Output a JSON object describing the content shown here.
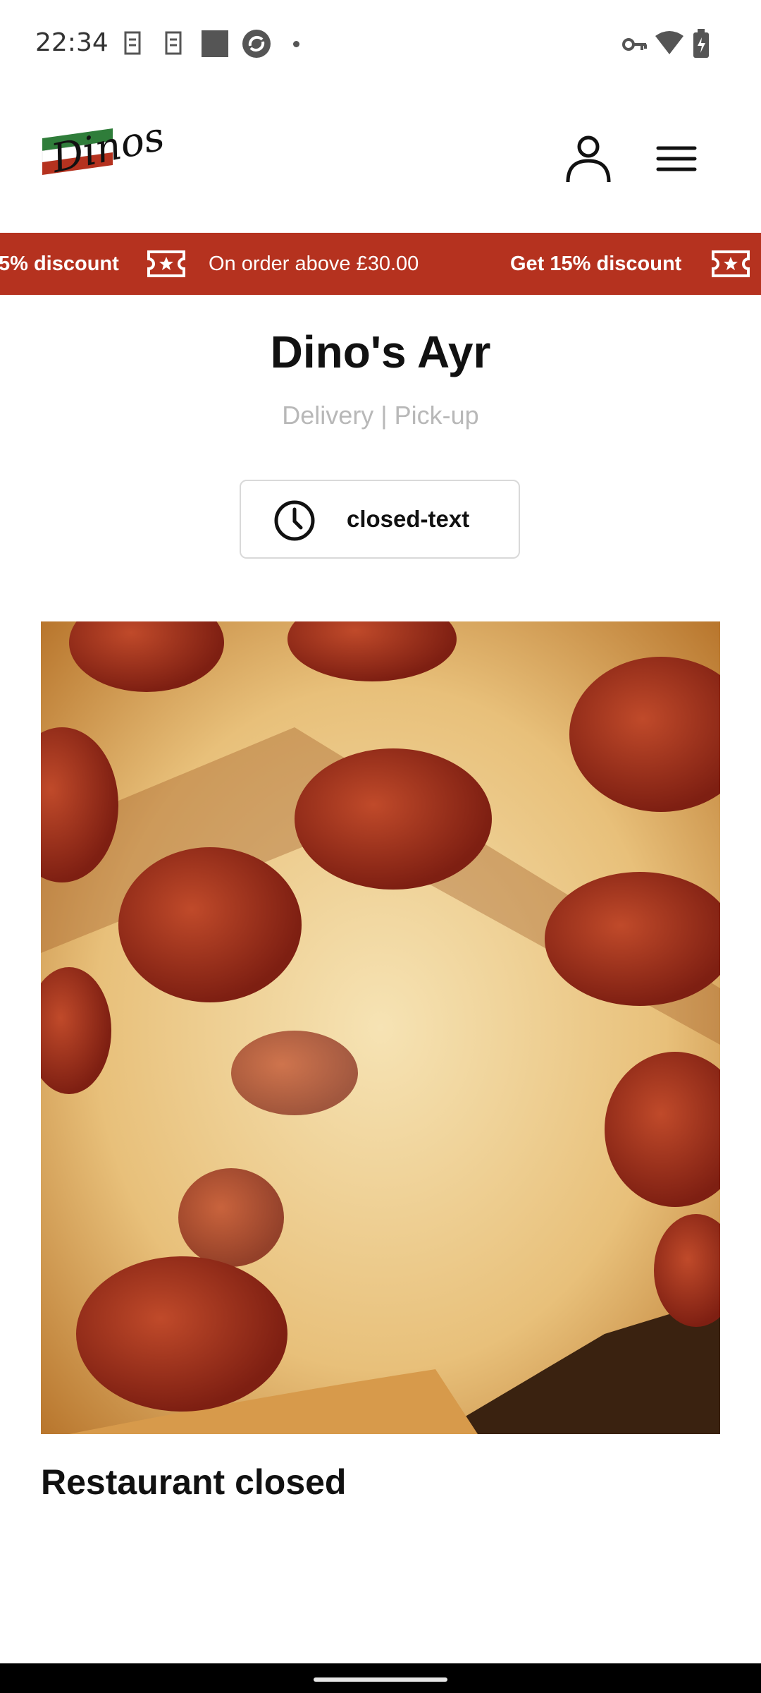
{
  "status_bar": {
    "time": "22:34",
    "icons": [
      "sim-icon",
      "sim-icon",
      "image-icon",
      "sync-icon",
      "dot-icon",
      "vpn-key-icon",
      "wifi-icon",
      "battery-icon"
    ]
  },
  "header": {
    "logo_text": "Dinos",
    "logo_colors": [
      "#2f7d3a",
      "#ffffff",
      "#b5321f"
    ],
    "account_icon": "person-icon",
    "menu_icon": "hamburger-menu-icon"
  },
  "promo": {
    "background": "#b5321f",
    "items": [
      {
        "bold": "5% discount",
        "icon": "ticket-star-icon"
      },
      {
        "text": "On order above £30.00"
      },
      {
        "bold": "Get 15% discount",
        "icon": "ticket-star-icon"
      }
    ]
  },
  "restaurant": {
    "name": "Dino's Ayr",
    "service_modes": "Delivery | Pick-up",
    "status_label": "closed-text",
    "status_icon": "clock-icon"
  },
  "content": {
    "closed_heading": "Restaurant closed"
  }
}
